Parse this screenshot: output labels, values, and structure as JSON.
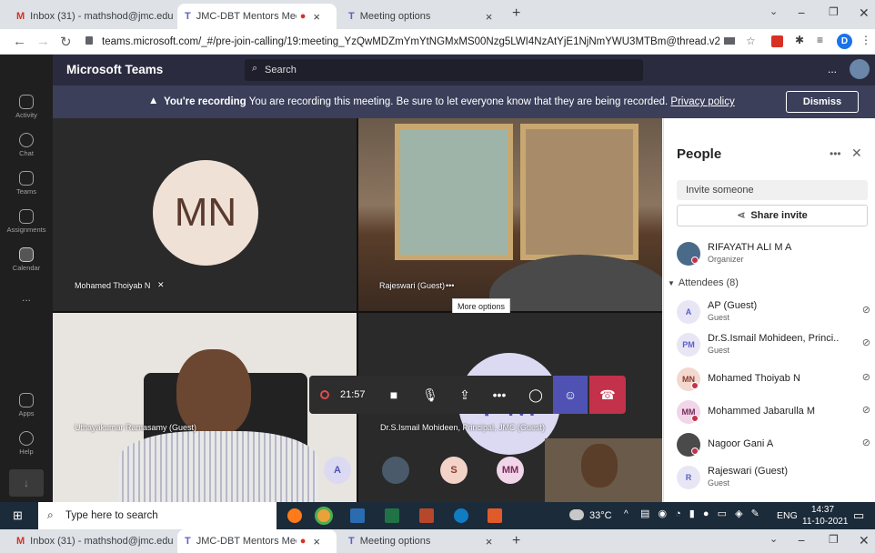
{
  "browser": {
    "tabs": [
      {
        "label": "Inbox (31) - mathshod@jmc.edu",
        "icon": "gmail-icon"
      },
      {
        "label": "JMC-DBT Mentors Meeting",
        "icon": "teams-icon"
      },
      {
        "label": "Meeting options",
        "icon": "teams-icon"
      }
    ],
    "url": "teams.microsoft.com/_#/pre-join-calling/19:meeting_YzQwMDZmYmYtNGMxMS00Nzg5LWI4NzAtYjE1NjNmYWU3MTBm@thread.v2",
    "profile_initial": "D",
    "new_tab": "+"
  },
  "teams": {
    "app_name": "Microsoft Teams",
    "search_placeholder": "Search",
    "more": "...",
    "rail": [
      {
        "label": "Activity"
      },
      {
        "label": "Chat"
      },
      {
        "label": "Teams"
      },
      {
        "label": "Assignments"
      },
      {
        "label": "Calendar"
      },
      {
        "label": "..."
      },
      {
        "label": "Apps"
      },
      {
        "label": "Help"
      }
    ],
    "banner": {
      "bold": "You're recording",
      "text": "You are recording this meeting. Be sure to let everyone know that they are being recorded.",
      "link": "Privacy policy",
      "dismiss": "Dismiss"
    },
    "tiles": {
      "t1": {
        "initials": "MN",
        "name": "Mohamed Thoiyab N"
      },
      "t2": {
        "name": "Rajeswari (Guest)",
        "more": "•••",
        "tooltip": "More options"
      },
      "t3": {
        "name": "Uthayakumar Ramasamy (Guest)"
      },
      "t4": {
        "initials": "PM",
        "name": "Dr.S.Ismail Mohideen, Principal, JMC (Guest)"
      }
    },
    "bottom_avatars": [
      "A",
      "S",
      "MM"
    ],
    "controls": {
      "timer": "21:57",
      "more": "•••"
    },
    "people": {
      "title": "People",
      "more": "•••",
      "invite_placeholder": "Invite someone",
      "share_invite": "Share invite",
      "organizer": {
        "name": "RIFAYATH ALI M A",
        "role": "Organizer"
      },
      "attendees_header": "Attendees (8)",
      "attendees": [
        {
          "initials": "A",
          "name": "AP (Guest)",
          "sub": "Guest"
        },
        {
          "initials": "PM",
          "name": "Dr.S.Ismail Mohideen, Princi...",
          "sub": "Guest"
        },
        {
          "initials": "MN",
          "name": "Mohamed Thoiyab N",
          "sub": ""
        },
        {
          "initials": "MM",
          "name": "Mohammed Jabarulla M",
          "sub": ""
        },
        {
          "initials": "",
          "name": "Nagoor Gani A",
          "sub": ""
        },
        {
          "initials": "R",
          "name": "Rajeswari (Guest)",
          "sub": "Guest"
        }
      ]
    }
  },
  "taskbar": {
    "search": "Type here to search",
    "weather": "33°C",
    "lang": "ENG",
    "time": "14:37",
    "date": "11-10-2021"
  },
  "colors": {
    "brand": "#5b5fc7",
    "hangup": "#c4314b",
    "rail": "#1f1f1f",
    "topbar": "#2b2b40",
    "banner": "#3b3f5a"
  }
}
